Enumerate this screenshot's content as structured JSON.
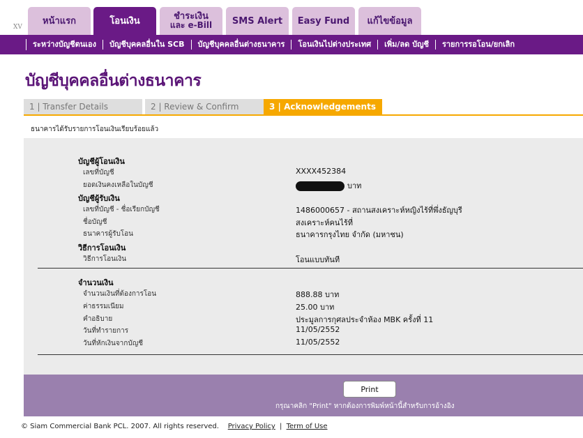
{
  "version_mark": "XV",
  "tabs": [
    {
      "label": "หน้าแรก",
      "sub": ""
    },
    {
      "label": "โอนเงิน",
      "sub": ""
    },
    {
      "label": "ชำระเงิน",
      "sub": "และ e-Bill"
    },
    {
      "label": "SMS Alert",
      "sub": ""
    },
    {
      "label": "Easy Fund",
      "sub": ""
    },
    {
      "label": "แก้ไขข้อมูล",
      "sub": ""
    }
  ],
  "subnav": [
    "ระหว่างบัญชีตนเอง",
    "บัญชีบุคคลอื่นใน SCB",
    "บัญชีบุคคลอื่นต่างธนาคาร",
    "โอนเงินไปต่างประเทศ",
    "เพิ่ม/ลด บัญชี",
    "รายการรอโอน/ยกเลิก"
  ],
  "page_title": "บัญชีบุคคลอื่นต่างธนาคาร",
  "steps": [
    "1 | Transfer Details",
    "2 | Review & Confirm",
    "3 | Acknowledgements"
  ],
  "note": "ธนาคารได้รับรายการโอนเงินเรียบร้อยแล้ว",
  "details": {
    "from_section": "บัญชีผู้โอนเงิน",
    "from_account_label": "เลขที่บัญชี",
    "from_account_value": "XXXX452384",
    "balance_label": "ยอดเงินคงเหลือในบัญชี",
    "balance_unit": "บาท",
    "to_section": "บัญชีผู้รับเงิน",
    "to_account_label": "เลขที่บัญชี - ชื่อเรียกบัญชี",
    "to_account_value": "1486000657 - สถานสงเคราะห์หญิงไร้ที่พึ่งธัญบุรี",
    "account_name_label": "ชื่อบัญชี",
    "account_name_value": "สงเคราะห์คนไร้ที่",
    "bank_label": "ธนาคารผู้รับโอน",
    "bank_value": "ธนาคารกรุงไทย จำกัด (มหาชน)",
    "method_section": "วิธีการโอนเงิน",
    "method_label": "วิธีการโอนเงิน",
    "method_value": "โอนแบบทันที",
    "amount_section": "จำนวนเงิน",
    "amount_label": "จำนวนเงินที่ต้องการโอน",
    "amount_value": "888.88 บาท",
    "fee_label": "ค่าธรรมเนียม",
    "fee_value": "25.00  บาท",
    "desc_label": "คำอธิบาย",
    "desc_value": "ประมูลการกุศลประจำห้อง MBK ครั้งที่ 11",
    "txn_date_label": "วันที่ทำรายการ",
    "txn_date_value": "11/05/2552",
    "debit_date_label": "วันที่หักเงินจากบัญชี",
    "debit_date_value": "11/05/2552"
  },
  "print_label": "Print",
  "print_hint": "กรุณาคลิก \"Print\" หากต้องการพิมพ์หน้านี้สำหรับการอ้างอิง",
  "footer": {
    "copyright": "© Siam Commercial Bank PCL. 2007. All rights reserved.",
    "privacy": "Privacy Policy",
    "separator": "|",
    "terms": "Term of Use"
  },
  "colors": {
    "purple": "#6a1a86",
    "tab_inactive": "#dcc0dc",
    "step_active": "#f6a800",
    "footer_box": "#9a80ae"
  }
}
